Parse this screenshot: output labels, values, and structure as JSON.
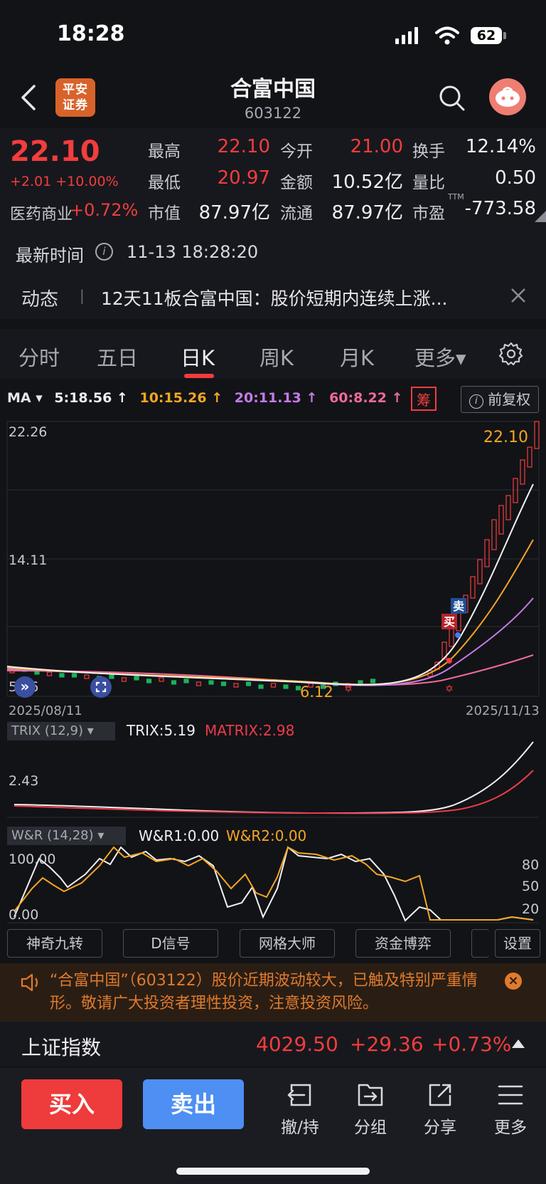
{
  "status_bar": {
    "time": "18:28",
    "battery": "62"
  },
  "header": {
    "logo_text": "平安证券",
    "stock_name": "合富中国",
    "stock_code": "603122"
  },
  "quote": {
    "price": "22.10",
    "change": "+2.01 +10.00%",
    "sector_label": "医药商业",
    "sector_change": "+0.72%",
    "fields": {
      "high_label": "最高",
      "high": "22.10",
      "open_label": "今开",
      "open": "21.00",
      "turnover_label": "换手",
      "turnover": "12.14%",
      "low_label": "最低",
      "low": "20.97",
      "amount_label": "金额",
      "amount": "10.52亿",
      "vol_ratio_label": "量比",
      "vol_ratio": "0.50",
      "mktcap_label": "市值",
      "mktcap": "87.97亿",
      "float_label": "流通",
      "float": "87.97亿",
      "pe_label": "市盈",
      "pe_sup": "TTM",
      "pe": "-773.58"
    },
    "update_label": "最新时间",
    "update_time": "11-13 18:28:20"
  },
  "news": {
    "label": "动态",
    "separator": "|",
    "headline": "12天11板合富中国：股价短期内连续上涨..."
  },
  "tabs": [
    {
      "label": "分时"
    },
    {
      "label": "五日"
    },
    {
      "label": "日K"
    },
    {
      "label": "周K"
    },
    {
      "label": "月K"
    },
    {
      "label": "更多▾"
    }
  ],
  "ma_legend": {
    "label": "MA ▾",
    "ma5": "5:18.56 ↑",
    "ma10": "10:15.26 ↑",
    "ma20": "20:11.13 ↑",
    "ma60": "60:8.22 ↑",
    "chip_button": "筹",
    "adjust_button": "前复权"
  },
  "kchart": {
    "y_top": "22.26",
    "y_mid": "14.11",
    "y_bottom": "5.96",
    "last_price_label": "22.10",
    "low_label": "6.12",
    "date_start": "2025/08/11",
    "date_end": "2025/11/13",
    "sell_marker": "卖",
    "buy_marker": "买"
  },
  "trix": {
    "label": "TRIX (12,9) ▾",
    "trix_value": "TRIX:5.19",
    "matrix_value": "MATRIX:2.98",
    "y_label": "2.43"
  },
  "wr": {
    "label": "W&R (14,28) ▾",
    "wr1": "W&R1:0.00",
    "wr2": "W&R2:0.00",
    "y_top": "100.00",
    "y_bottom": "0.00",
    "r80": "80",
    "r50": "50",
    "r20": "20"
  },
  "tools": [
    "神奇九转",
    "D信号",
    "网格大师",
    "资金博弈"
  ],
  "tools_settings": "设置",
  "warning": {
    "text": "“合富中国”（603122）股价近期波动较大，已触及特别严重情形。敬请广大投资者理性投资，注意投资风险。"
  },
  "index": {
    "name": "上证指数",
    "value": "4029.50",
    "change": "+29.36",
    "pct": "+0.73%"
  },
  "bottom_bar": {
    "buy": "买入",
    "sell": "卖出",
    "cancel": "撤/持",
    "group": "分组",
    "share": "分享",
    "more": "更多"
  },
  "colors": {
    "up": "#f23d3d",
    "down": "#19b25a",
    "ma5": "#f0f0f2",
    "ma10": "#f5a623",
    "ma20": "#c47be8",
    "ma60": "#ee6a9b",
    "buy_button": "#ee3b3b",
    "sell_button": "#4d8ff2"
  }
}
